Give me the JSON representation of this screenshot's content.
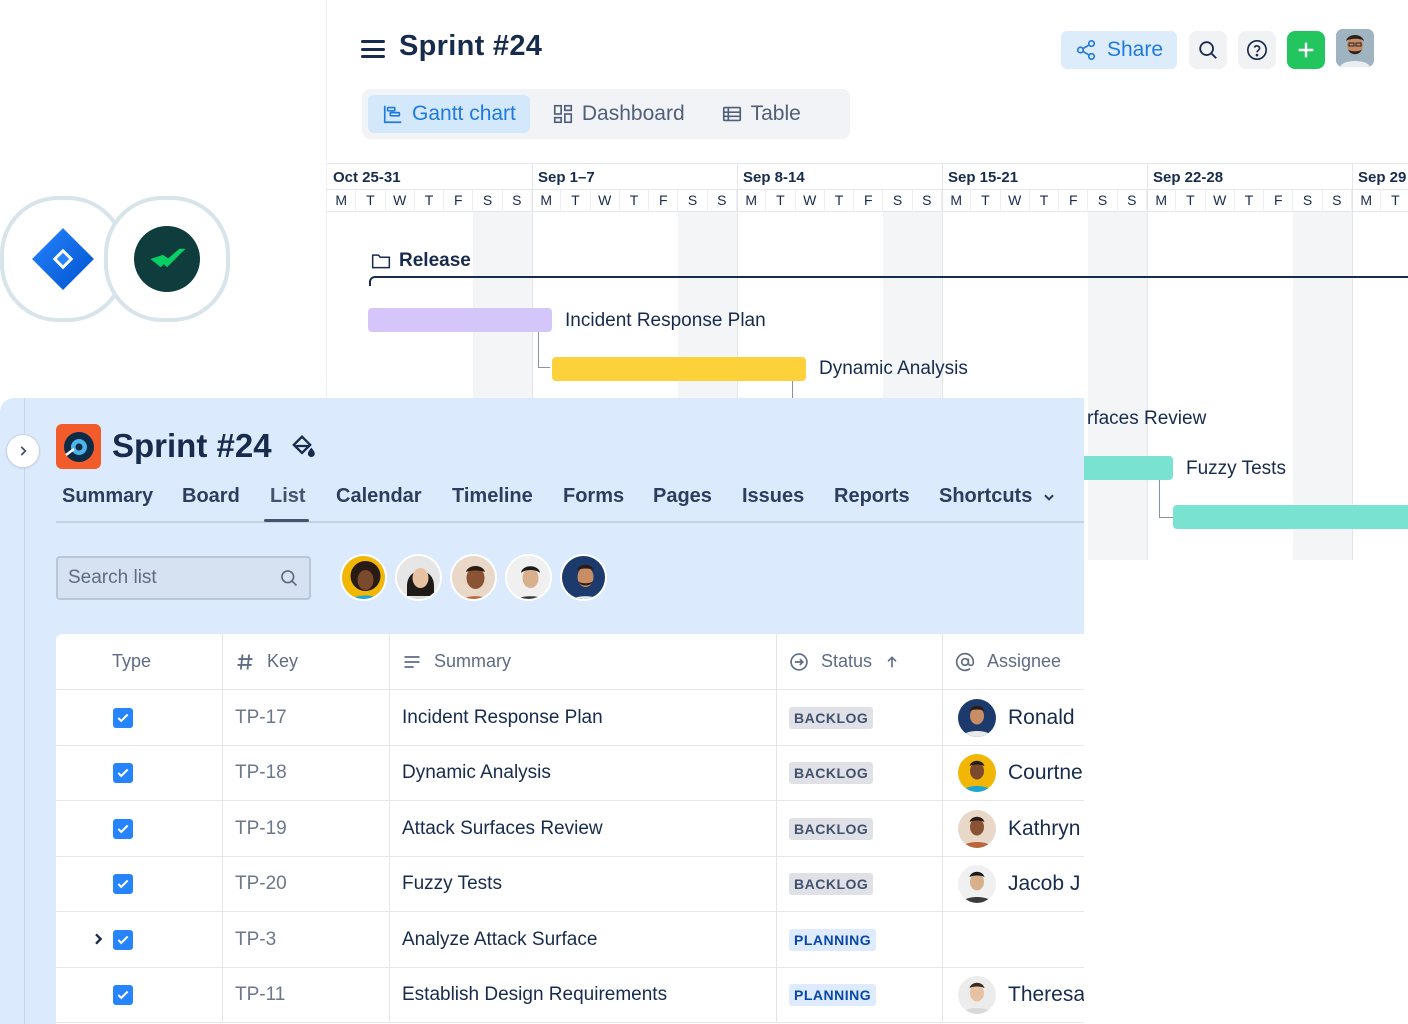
{
  "gantt": {
    "title": "Sprint #24",
    "share_label": "Share",
    "tabs": [
      {
        "label": "Gantt chart",
        "icon": "gantt-icon",
        "active": true
      },
      {
        "label": "Dashboard",
        "icon": "dashboard-icon",
        "active": false
      },
      {
        "label": "Table",
        "icon": "table-icon",
        "active": false
      }
    ],
    "weeks": [
      "Oct 25-31",
      "Sep 1–7",
      "Sep 8-14",
      "Sep 15-21",
      "Sep 22-28",
      "Sep 29"
    ],
    "days": [
      "M",
      "T",
      "W",
      "T",
      "F",
      "S",
      "S"
    ],
    "release_label": "Release",
    "tasks": [
      {
        "name": "Incident Response Plan",
        "color": "#d4c6fb"
      },
      {
        "name": "Dynamic Analysis",
        "color": "#fdd13a"
      },
      {
        "name": "rfaces Review",
        "color": "#79e2d0"
      },
      {
        "name": "Fuzzy Tests",
        "color": "#79e2d0"
      }
    ]
  },
  "jira": {
    "project_title": "Sprint #24",
    "tabs": [
      "Summary",
      "Board",
      "List",
      "Calendar",
      "Timeline",
      "Forms",
      "Pages",
      "Issues",
      "Reports",
      "Shortcuts"
    ],
    "active_tab": "List",
    "search_placeholder": "Search list",
    "columns": {
      "type": "Type",
      "key": "Key",
      "summary": "Summary",
      "status": "Status",
      "assignee": "Assignee"
    },
    "rows": [
      {
        "key": "TP-17",
        "summary": "Incident Response Plan",
        "status": "BACKLOG",
        "assignee": "Ronald"
      },
      {
        "key": "TP-18",
        "summary": "Dynamic Analysis",
        "status": "BACKLOG",
        "assignee": "Courtne"
      },
      {
        "key": "TP-19",
        "summary": "Attack Surfaces Review",
        "status": "BACKLOG",
        "assignee": "Kathryn"
      },
      {
        "key": "TP-20",
        "summary": "Fuzzy Tests",
        "status": "BACKLOG",
        "assignee": "Jacob J"
      },
      {
        "key": "TP-3",
        "summary": "Analyze Attack Surface",
        "status": "PLANNING",
        "assignee": ""
      },
      {
        "key": "TP-11",
        "summary": "Establish Design Requirements",
        "status": "PLANNING",
        "assignee": "Theresa"
      }
    ]
  },
  "colors": {
    "accent": "#1f7ae0",
    "jira_bg": "#dbeafc",
    "wrike_green": "#08cf65",
    "jira_blue": "#2684ff"
  }
}
